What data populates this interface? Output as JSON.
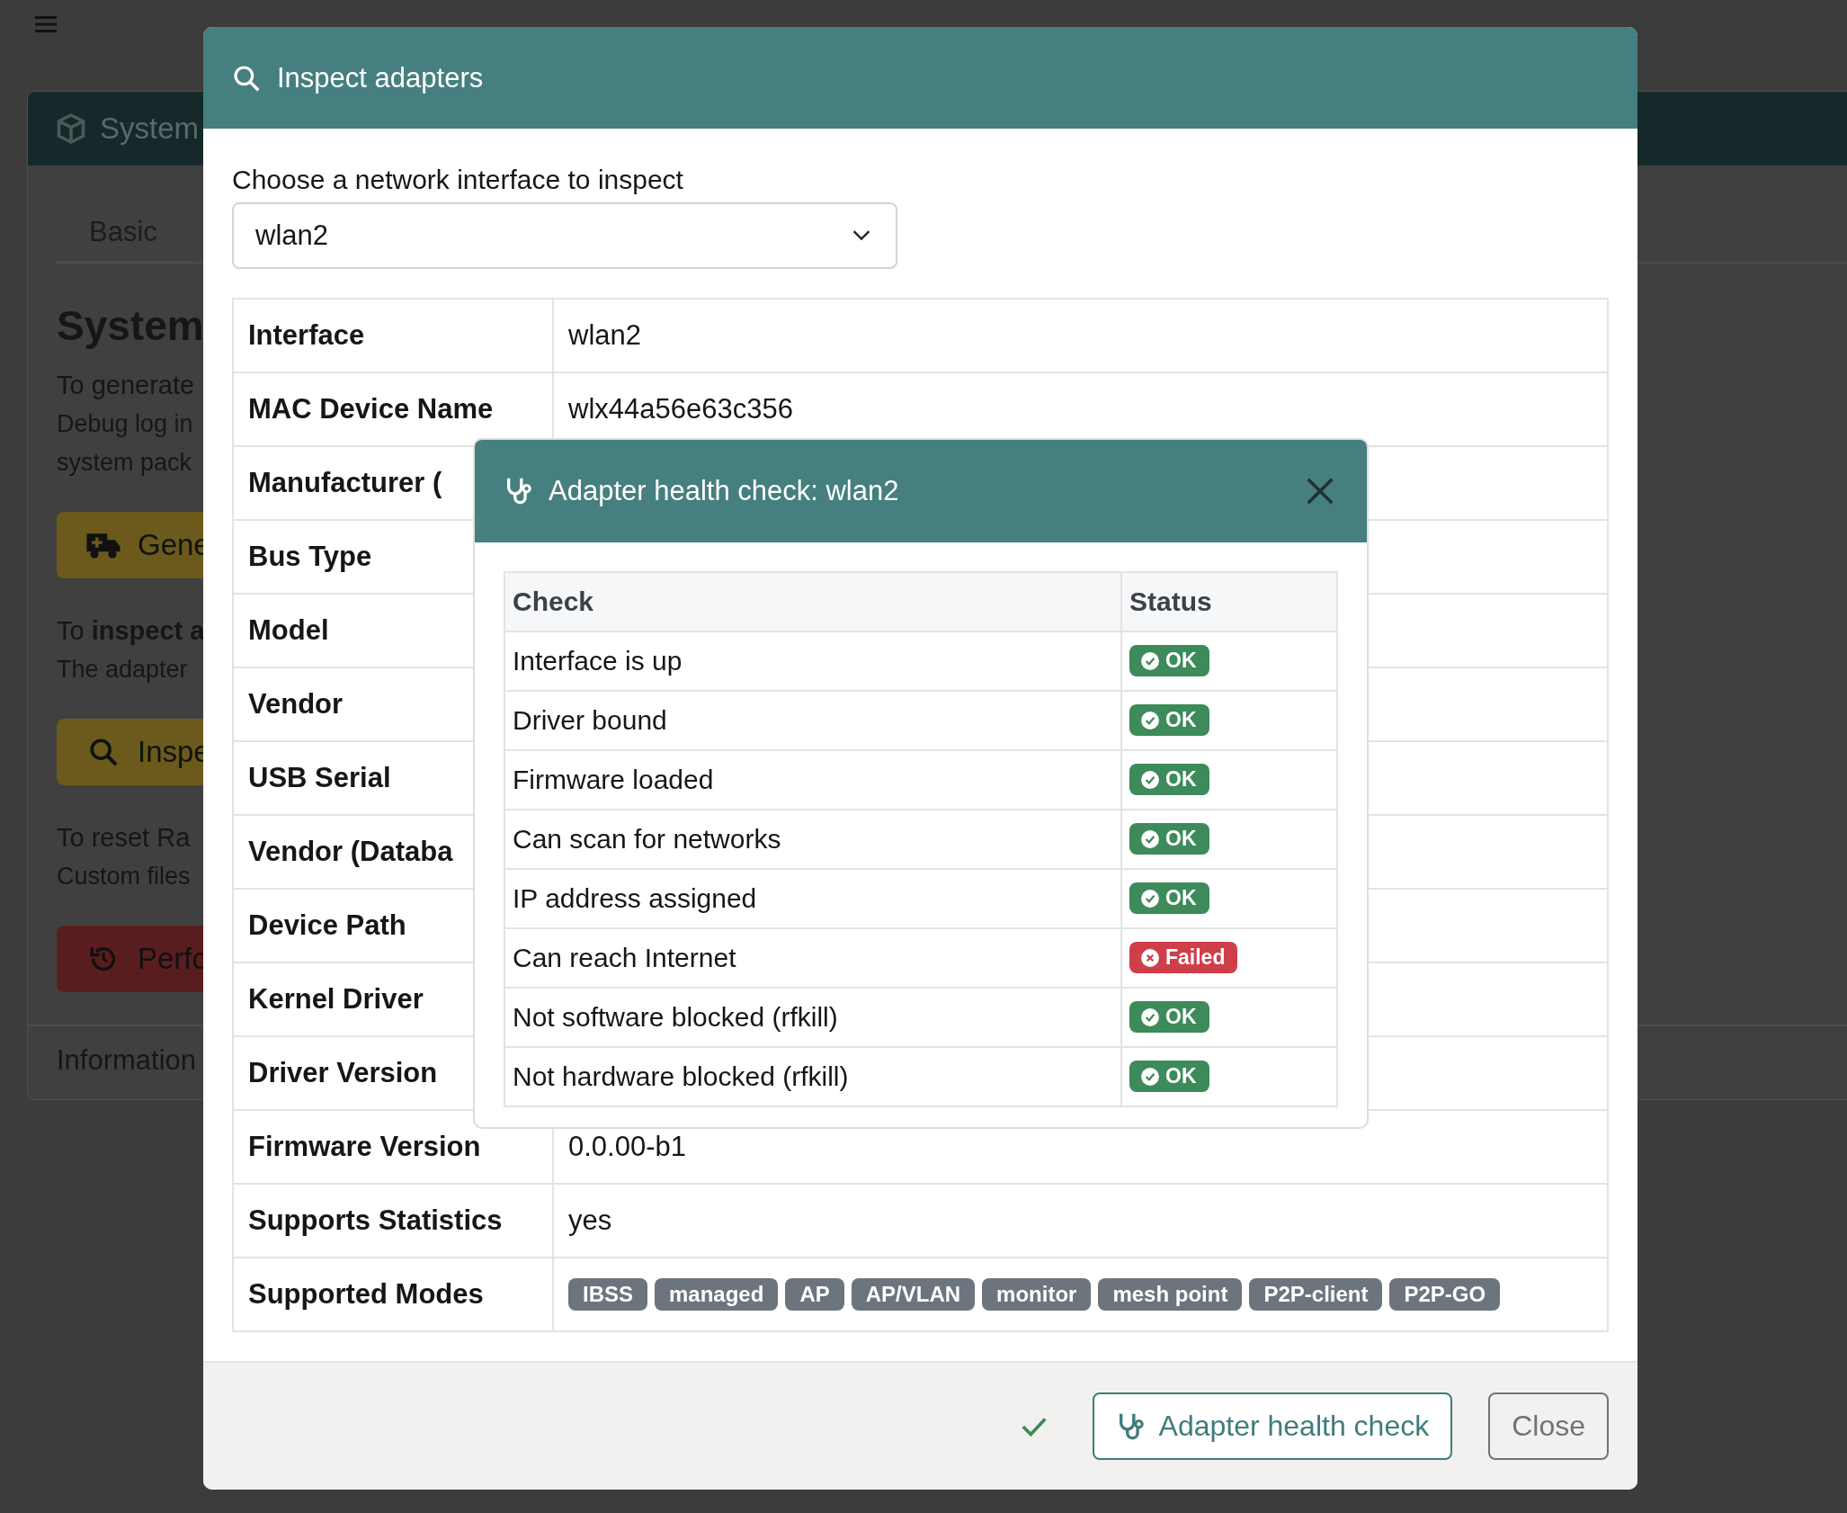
{
  "background": {
    "card_title": "System",
    "tabs": [
      {
        "label": "Basic",
        "selected": true
      }
    ],
    "heading": "System",
    "sections": [
      {
        "lines": [
          "To generate",
          "Debug log in",
          "system pack"
        ],
        "button": {
          "label": "Gene",
          "kind": "truck"
        }
      },
      {
        "lines": [
          "To **inspect a**",
          "The adapter"
        ],
        "button": {
          "label": "Inspe",
          "kind": "search"
        }
      },
      {
        "lines": [
          "To reset Ra",
          "Custom files"
        ],
        "button": {
          "label": "Perfo",
          "kind": "reset"
        }
      }
    ],
    "footer": "Information"
  },
  "modal": {
    "title": "Inspect adapters",
    "field_label": "Choose a network interface to inspect",
    "select_value": "wlan2",
    "properties": [
      {
        "label": "Interface",
        "value": "wlan2"
      },
      {
        "label": "MAC Device Name",
        "value": "wlx44a56e63c356"
      },
      {
        "label": "Manufacturer ("
      },
      {
        "label": "Bus Type"
      },
      {
        "label": "Model"
      },
      {
        "label": "Vendor"
      },
      {
        "label": "USB Serial"
      },
      {
        "label": "Vendor (Databa"
      },
      {
        "label": "Device Path"
      },
      {
        "label": "Kernel Driver"
      },
      {
        "label": "Driver Version"
      },
      {
        "label": "Firmware Version",
        "value": "0.0.00-b1"
      },
      {
        "label": "Supports Statistics",
        "value": "yes"
      },
      {
        "label": "Supported Modes",
        "tags": [
          "IBSS",
          "managed",
          "AP",
          "AP/VLAN",
          "monitor",
          "mesh point",
          "P2P-client",
          "P2P-GO"
        ]
      }
    ],
    "footer": {
      "done": true,
      "health_button": "Adapter health check",
      "close_button": "Close"
    }
  },
  "health_dialog": {
    "title": "Adapter health check: wlan2",
    "columns": [
      "Check",
      "Status"
    ],
    "rows": [
      {
        "check": "Interface is up",
        "status": "OK",
        "failed": false
      },
      {
        "check": "Driver bound",
        "status": "OK",
        "failed": false
      },
      {
        "check": "Firmware loaded",
        "status": "OK",
        "failed": false
      },
      {
        "check": "Can scan for networks",
        "status": "OK",
        "failed": false
      },
      {
        "check": "IP address assigned",
        "status": "OK",
        "failed": false
      },
      {
        "check": "Can reach Internet",
        "status": "Failed",
        "failed": true
      },
      {
        "check": "Not software blocked (rfkill)",
        "status": "OK",
        "failed": false
      },
      {
        "check": "Not hardware blocked (rfkill)",
        "status": "OK",
        "failed": false
      }
    ]
  }
}
